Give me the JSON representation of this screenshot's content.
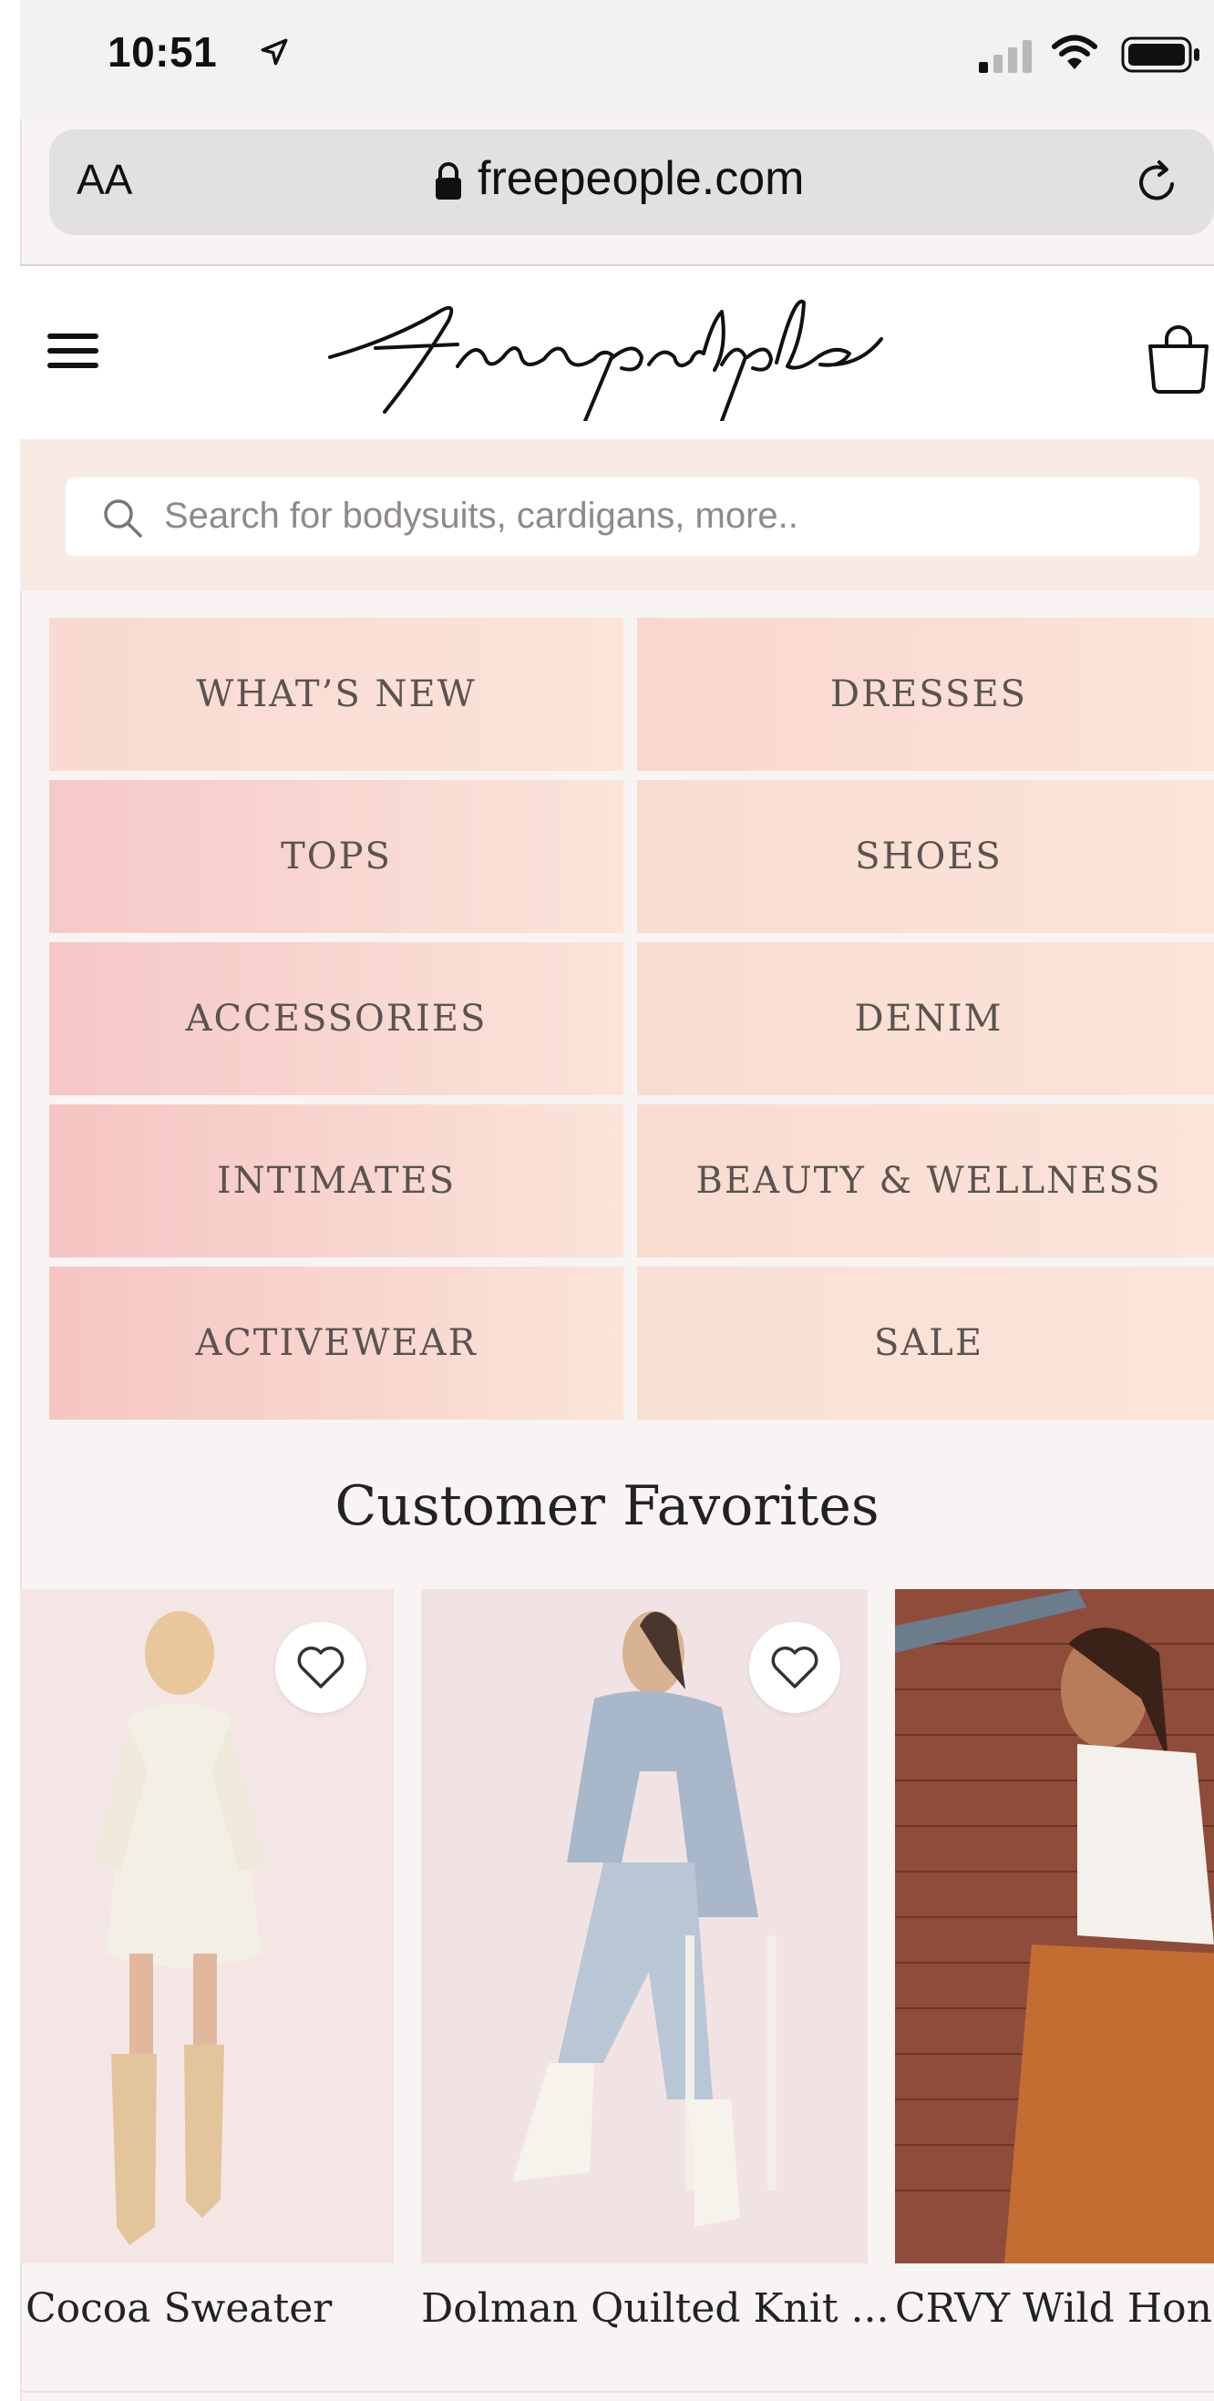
{
  "status": {
    "time": "10:51"
  },
  "browser": {
    "text_size_label": "AA",
    "domain": "freepeople.com"
  },
  "header": {
    "logo_text": "free people"
  },
  "search": {
    "placeholder": "Search for bodysuits, cardigans, more.."
  },
  "categories": [
    {
      "label": "WHAT’S NEW",
      "color": "#f9d9d1"
    },
    {
      "label": "DRESSES",
      "color": "#f9d6cf"
    },
    {
      "label": "TOPS",
      "color": "#f6c9c9"
    },
    {
      "label": "SHOES",
      "color": "#f9dcd0"
    },
    {
      "label": "ACCESSORIES",
      "color": "#f5c7c6"
    },
    {
      "label": "DENIM",
      "color": "#f9dcd0"
    },
    {
      "label": "INTIMATES",
      "color": "#f5c4c3"
    },
    {
      "label": "BEAUTY & WELLNESS",
      "color": "#f9dbd0"
    },
    {
      "label": "ACTIVEWEAR",
      "color": "#f5c5c2"
    },
    {
      "label": "SALE",
      "color": "#f9e0d4"
    }
  ],
  "favorites": {
    "title": "Customer Favorites",
    "products": [
      {
        "name": "Cocoa Sweater"
      },
      {
        "name": "Dolman Quilted Knit ..."
      },
      {
        "name": "CRVY Wild Hone"
      }
    ]
  }
}
